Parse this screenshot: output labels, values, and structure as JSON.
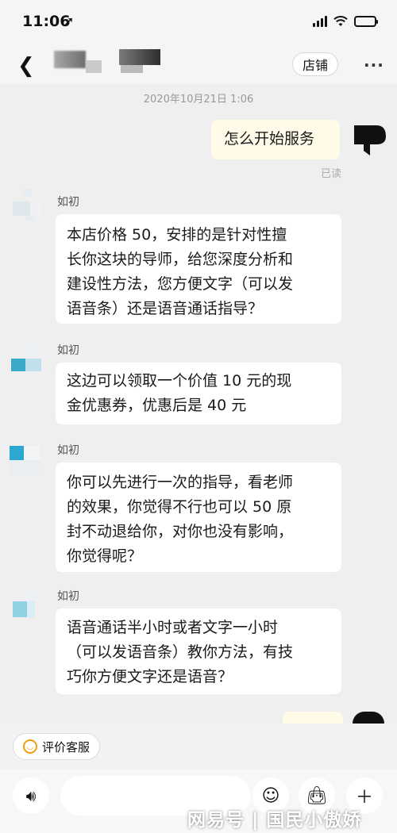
{
  "status_bar": {
    "time": "11:06"
  },
  "nav": {
    "shop_button": "店铺"
  },
  "timestamp": "2020年10月21日 1:06",
  "messages": [
    {
      "from": "me",
      "text": "怎么开始服务",
      "read": "已读"
    },
    {
      "from": "shop",
      "name": "如初",
      "lines": [
        "本店价格 50，安排的是针对性擅",
        "长你这块的导师，给您深度分析和",
        "建设性方法，您方便文字（可以发",
        "语音条）还是语音通话指导？"
      ]
    },
    {
      "from": "shop",
      "name": "如初",
      "lines": [
        "这边可以领取一个价值 10 元的现",
        "金优惠券，优惠后是 40 元"
      ]
    },
    {
      "from": "shop",
      "name": "如初",
      "lines": [
        "你可以先进行一次的指导，看老师",
        "的效果，你觉得不行也可以 50 原",
        "封不动退给你，对你也没有影响，",
        "你觉得呢？"
      ]
    },
    {
      "from": "shop",
      "name": "如初",
      "lines": [
        "语音通话半小时或者文字一小时",
        "（可以发语音条）教你方法，有技",
        "巧你方便文字还是语音？"
      ]
    }
  ],
  "bottom": {
    "rate_button": "评价客服"
  },
  "watermark": "网易号 | 国民小傲娇",
  "icons": [
    "location-arrow-icon",
    "signal-icon",
    "wifi-icon",
    "battery-icon",
    "back-chevron-icon",
    "more-icon",
    "smile-icon",
    "voice-icon",
    "emoji-icon",
    "bag-icon",
    "plus-icon"
  ]
}
